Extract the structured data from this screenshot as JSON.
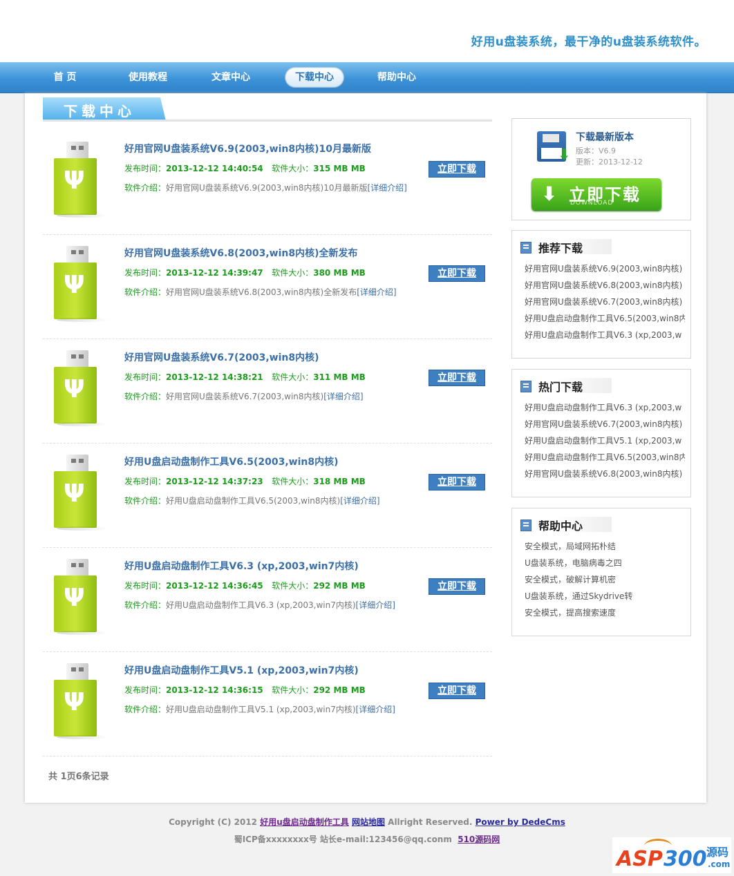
{
  "header": {
    "slogan": "好用u盘装系统，最干净的u盘装系统软件。"
  },
  "nav": [
    {
      "label": "首 页",
      "active": false
    },
    {
      "label": "使用教程",
      "active": false
    },
    {
      "label": "文章中心",
      "active": false
    },
    {
      "label": "下载中心",
      "active": true
    },
    {
      "label": "帮助中心",
      "active": false
    }
  ],
  "section": {
    "title": "下载中心"
  },
  "labels": {
    "publish": "发布时间：",
    "size": "软件大小：",
    "intro": "软件介绍：",
    "more": "[详细介绍]",
    "download": "立即下载"
  },
  "items": [
    {
      "title": "好用官网U盘装系统V6.9(2003,win8内核)10月最新版",
      "date": "2013-12-12 14:40:54",
      "size": "315 MB MB",
      "desc": "好用官网U盘装系统V6.9(2003,win8内核)10月最新版"
    },
    {
      "title": "好用官网U盘装系统V6.8(2003,win8内核)全新发布",
      "date": "2013-12-12 14:39:47",
      "size": "380 MB MB",
      "desc": "好用官网U盘装系统V6.8(2003,win8内核)全新发布"
    },
    {
      "title": "好用官网U盘装系统V6.7(2003,win8内核)",
      "date": "2013-12-12 14:38:21",
      "size": "311 MB MB",
      "desc": "好用官网U盘装系统V6.7(2003,win8内核)"
    },
    {
      "title": "好用U盘启动盘制作工具V6.5(2003,win8内核)",
      "date": "2013-12-12 14:37:23",
      "size": "318 MB MB",
      "desc": "好用U盘启动盘制作工具V6.5(2003,win8内核)"
    },
    {
      "title": "好用U盘启动盘制作工具V6.3 (xp,2003,win7内核)",
      "date": "2013-12-12 14:36:45",
      "size": "292 MB MB",
      "desc": "好用U盘启动盘制作工具V6.3 (xp,2003,win7内核)"
    },
    {
      "title": "好用U盘启动盘制作工具V5.1 (xp,2003,win7内核)",
      "date": "2013-12-12 14:36:15",
      "size": "292 MB MB",
      "desc": "好用U盘启动盘制作工具V5.1 (xp,2003,win7内核)"
    }
  ],
  "pagination": {
    "total": "共 1页6条记录"
  },
  "latest": {
    "title": "下载最新版本",
    "version": "版本：V6.9",
    "updated": "更新：2013-12-12",
    "button": "立即下载",
    "button_sub": "DOWNLOAD"
  },
  "recommend": {
    "title": "推荐下载",
    "items": [
      "好用官网U盘装系统V6.9(2003,win8内核)",
      "好用官网U盘装系统V6.8(2003,win8内核)",
      "好用官网U盘装系统V6.7(2003,win8内核)",
      "好用U盘启动盘制作工具V6.5(2003,win8内",
      "好用U盘启动盘制作工具V6.3 (xp,2003,w"
    ]
  },
  "hot": {
    "title": "热门下载",
    "items": [
      "好用U盘启动盘制作工具V6.3 (xp,2003,w",
      "好用官网U盘装系统V6.7(2003,win8内核)",
      "好用U盘启动盘制作工具V5.1 (xp,2003,w",
      "好用U盘启动盘制作工具V6.5(2003,win8内",
      "好用官网U盘装系统V6.8(2003,win8内核)"
    ]
  },
  "help": {
    "title": "帮助中心",
    "items": [
      "安全模式，局域网拓朴结",
      "U盘装系统，电脑病毒之四",
      "安全模式，破解计算机密",
      "U盘装系统，通过Skydrive转",
      "安全模式，提高搜索速度"
    ]
  },
  "footer": {
    "copyright": "Copyright (C) 2012",
    "site_link": "好用u盘启动盘制作工具",
    "sitemap": "网站地图",
    "rights": "Allright Reserved.",
    "power": "Power by DedeCms",
    "icp": "蜀ICP备xxxxxxxx号 站长e-mail:123456@qq.conm",
    "source": "510源码网"
  },
  "logo": {
    "asp": "ASP",
    "num": "300",
    "cn": "源码",
    "com": ".com"
  }
}
